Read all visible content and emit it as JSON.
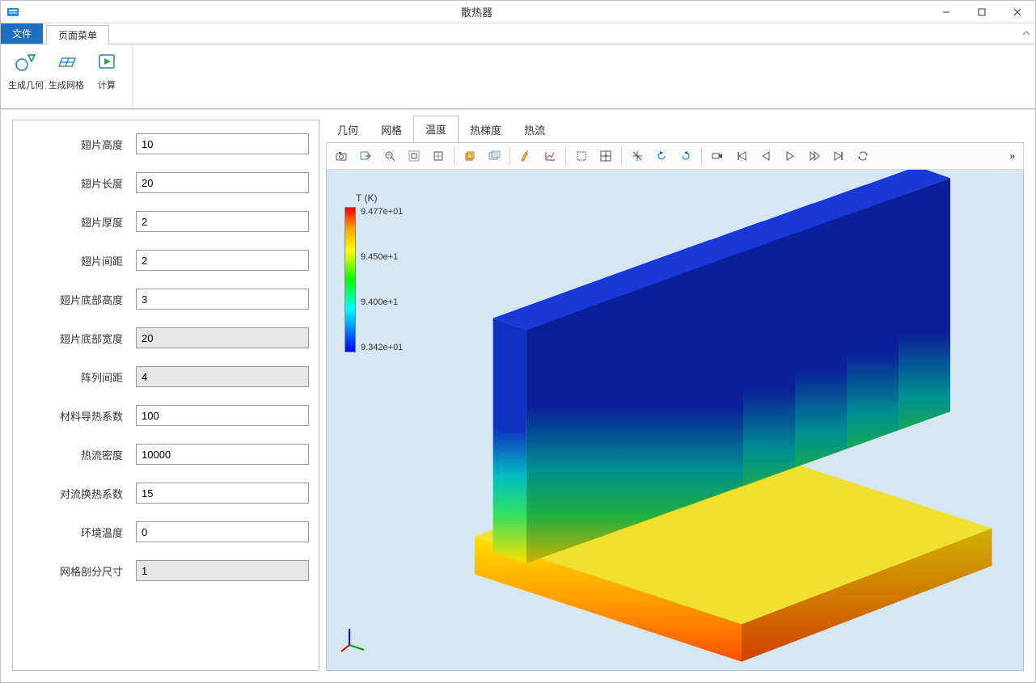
{
  "window": {
    "title": "散热器"
  },
  "menu": {
    "file": "文件",
    "app": "页面菜单"
  },
  "ribbon": {
    "gen_geom": "生成几何",
    "gen_mesh": "生成网格",
    "compute": "计算"
  },
  "params": [
    {
      "label": "翅片高度",
      "value": "10",
      "readonly": false
    },
    {
      "label": "翅片长度",
      "value": "20",
      "readonly": false
    },
    {
      "label": "翅片厚度",
      "value": "2",
      "readonly": false
    },
    {
      "label": "翅片间距",
      "value": "2",
      "readonly": false
    },
    {
      "label": "翅片底部高度",
      "value": "3",
      "readonly": false
    },
    {
      "label": "翅片底部宽度",
      "value": "20",
      "readonly": true
    },
    {
      "label": "阵列间距",
      "value": "4",
      "readonly": true
    },
    {
      "label": "材料导热系数",
      "value": "100",
      "readonly": false
    },
    {
      "label": "热流密度",
      "value": "10000",
      "readonly": false
    },
    {
      "label": "对流换热系数",
      "value": "15",
      "readonly": false
    },
    {
      "label": "环境温度",
      "value": "0",
      "readonly": false
    },
    {
      "label": "网格剖分尺寸",
      "value": "1",
      "readonly": true
    }
  ],
  "view_tabs": [
    {
      "label": "几何",
      "active": false
    },
    {
      "label": "网格",
      "active": false
    },
    {
      "label": "温度",
      "active": true
    },
    {
      "label": "热梯度",
      "active": false
    },
    {
      "label": "热流",
      "active": false
    }
  ],
  "legend": {
    "title": "T (K)",
    "ticks": [
      "9.477e+01",
      "9.450e+1",
      "9.400e+1",
      "9.342e+01"
    ]
  },
  "toolbar_icons": [
    "camera-icon",
    "export-image-icon",
    "zoom-fit-icon",
    "zoom-box-icon",
    "reset-zoom-icon",
    "scene-light-icon",
    "transparency-icon",
    "clear-icon",
    "plot-icon",
    "select-box-icon",
    "select-all-icon",
    "rotate-icon",
    "rotate-left-icon",
    "rotate-right-icon",
    "record-icon",
    "first-frame-icon",
    "prev-frame-icon",
    "play-icon",
    "next-frame-icon",
    "last-frame-icon",
    "loop-icon"
  ]
}
